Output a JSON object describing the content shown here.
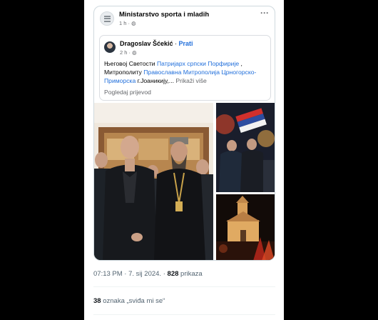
{
  "page": {
    "name": "Ministarstvo sporta i mladih",
    "time": "1 h",
    "more_icon": "···"
  },
  "shared_post": {
    "author": "Dragoslav Šćekić",
    "separator": " · ",
    "follow": "Prati",
    "time": "2 h",
    "text": {
      "line1_start": "Његовој Светости ",
      "link1": "Патријарх српски Порфирије",
      "line1_end": " ,",
      "line2_start": "Митрополиту ",
      "link2": "Православна Митрополија Црногорско-Приморска",
      "line2_end": " г.Јоаникију,... ",
      "see_more": "Prikaži više"
    },
    "translate": "Pogledaj prijevod"
  },
  "tweet_meta": {
    "time": "07:13 PM",
    "sep": " · ",
    "date": "7. sij 2024.",
    "sep2": " · ",
    "views": "828",
    "views_label": " prikaza"
  },
  "engagement": {
    "likes": "38",
    "likes_label": " oznaka „sviđa mi se“"
  },
  "colors": {
    "link": "#216fdb",
    "muted": "#65676b",
    "tweet_muted": "#536471"
  }
}
